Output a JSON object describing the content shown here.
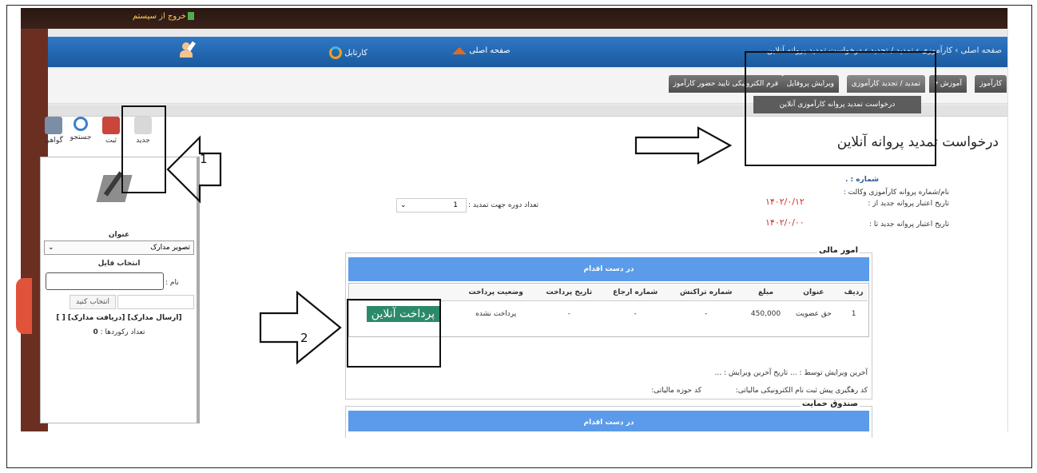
{
  "topbar": {
    "exit_label": "خروج از سیستم"
  },
  "nav": {
    "kartabl": "کارتابل",
    "home": "صفحه اصلی",
    "breadcrumb": "صفحه اصلی › کارآموزی › تمدید / تجدید › درخواست تمدید پروانه آنلاین"
  },
  "tabs": [
    {
      "label": "کارآموز"
    },
    {
      "label": "آموزش ▾"
    },
    {
      "label": "تمدید / تجدید کارآموزی"
    },
    {
      "label": "ویرایش پروفایل"
    },
    {
      "label": "فرم الکترونیکی تایید حضور کارآموز"
    }
  ],
  "dropdown_item": "درخواست تمدید پروانه کارآموزی آنلاین",
  "toolbar": {
    "new": "جدید",
    "save": "ثبت",
    "search": "جستجو",
    "cert": "گواهی"
  },
  "left_panel": {
    "title_label": "عنوان",
    "doc_select": "تصویر مدارک",
    "file_select_title": "انتخاب فایل",
    "name_label": "نام :",
    "pick_button": "انتخاب کنید",
    "links": "[ارسال مدارک] [دریافت مدارک] [ ]",
    "count_label": "تعداد رکوردها :",
    "count_value": "0"
  },
  "page_title": "درخواست تمدید پروانه آنلاین",
  "info": {
    "number_label": "شماره : .",
    "license_label": "نام/شماره پروانه کارآموزی وکالت :",
    "valid_from_label": "تاریخ اعتبار پروانه جدید از :",
    "valid_from_value": "۱۴۰۲/۰/۱۲",
    "valid_to_label": "تاریخ اعتبار پروانه جدید تا :",
    "valid_to_value": "۱۴۰۲/۰/۰۰",
    "period_label": "تعداد دوره جهت تمدید :",
    "period_value": "1"
  },
  "finance": {
    "legend": "امور مالی",
    "status_header": "در دست اقدام",
    "columns": [
      "ردیف",
      "عنوان",
      "مبلغ",
      "شماره تراکنش",
      "شماره ارجاع",
      "تاریخ پرداخت",
      "وضعیت پرداخت"
    ],
    "rows": [
      {
        "row": "1",
        "title": "حق عضویت",
        "amount": "450,000",
        "trans": "-",
        "ref": "-",
        "date": "-",
        "status": "پرداخت نشده"
      }
    ],
    "pay_button": "پرداخت آنلاین",
    "last_edit": "آخرین ویرایش توسط : ... تاریخ آخرین ویرایش : ...",
    "tracking": "کد رهگیری پیش ثبت نام الکترونیکی مالیاتی:",
    "tax_code": "کد حوزه مالیاتی:"
  },
  "fund": {
    "legend": "صندوق حمایت",
    "status_header": "در دست اقدام"
  },
  "annotations": {
    "one": "1",
    "two": "2"
  }
}
